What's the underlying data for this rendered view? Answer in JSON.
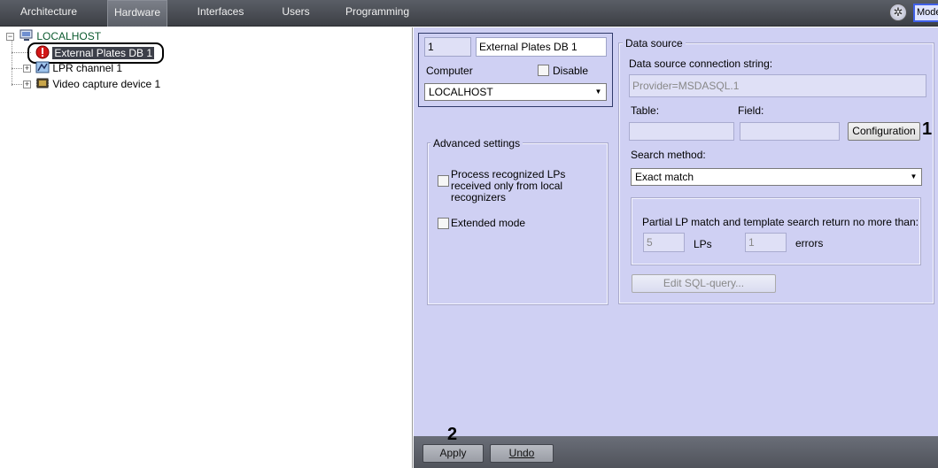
{
  "tabs": [
    {
      "label": "Architecture",
      "active": false
    },
    {
      "label": "Hardware",
      "active": true
    },
    {
      "label": "Interfaces",
      "active": false
    },
    {
      "label": "Users",
      "active": false
    },
    {
      "label": "Programming",
      "active": false
    }
  ],
  "top_right": {
    "mode_label": "Mode"
  },
  "tree": {
    "root": "LOCALHOST",
    "items": [
      {
        "label": "External Plates DB 1",
        "icon": "error-icon",
        "selected": true
      },
      {
        "label": "LPR channel 1",
        "icon": "lpr-channel-icon"
      },
      {
        "label": "Video capture device 1",
        "icon": "capture-card-icon"
      }
    ]
  },
  "object": {
    "id": "1",
    "name": "External Plates DB 1",
    "computer_label": "Computer",
    "disable_label": "Disable",
    "computer_value": "LOCALHOST"
  },
  "advanced": {
    "title": "Advanced settings",
    "process_local": "Process recognized LPs received only from local recognizers",
    "extended_mode": "Extended mode"
  },
  "datasource": {
    "title": "Data source",
    "conn_label": "Data source connection string:",
    "conn_value": "Provider=MSDASQL.1",
    "table_label": "Table:",
    "field_label": "Field:",
    "config_button": "Configuration",
    "search_label": "Search method:",
    "search_value": "Exact match",
    "partial_text": "Partial LP match and template search return no more than:",
    "lps_value": "5",
    "lps_label": "LPs",
    "errors_value": "1",
    "errors_label": "errors",
    "edit_sql": "Edit SQL-query..."
  },
  "footer": {
    "apply": "Apply",
    "undo": "Undo"
  },
  "callouts": {
    "one": "1",
    "two": "2"
  },
  "colors": {
    "panel": "#cfd0f3",
    "selection": "#3c3f49",
    "mode_border": "#4060e8"
  }
}
